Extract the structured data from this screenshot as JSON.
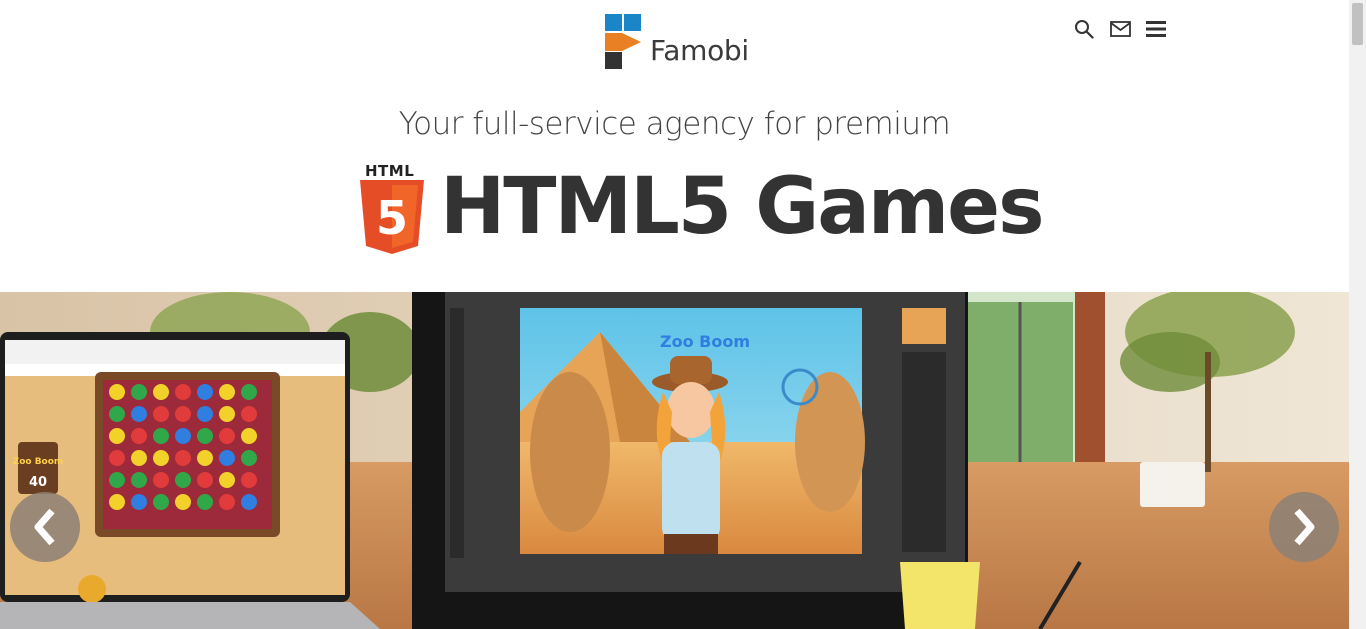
{
  "header": {
    "brand_name": "Famobi",
    "icons": [
      "search-icon",
      "mail-icon",
      "menu-icon"
    ]
  },
  "hero_text": {
    "tagline": "Your full-service agency for premium",
    "badge_word": "HTML",
    "badge_digit": "5",
    "headline": "HTML5 Games"
  },
  "brand_colors": {
    "logo_blue": "#1a86c8",
    "logo_orange": "#e98024",
    "logo_dark": "#333333",
    "html5_orange": "#e44d26",
    "html5_orange_light": "#f16529"
  },
  "carousel": {
    "prev_icon": "chevron-left-icon",
    "next_icon": "chevron-right-icon",
    "screen_game_title": "Zoo Boom",
    "laptop_game_level": "40"
  }
}
